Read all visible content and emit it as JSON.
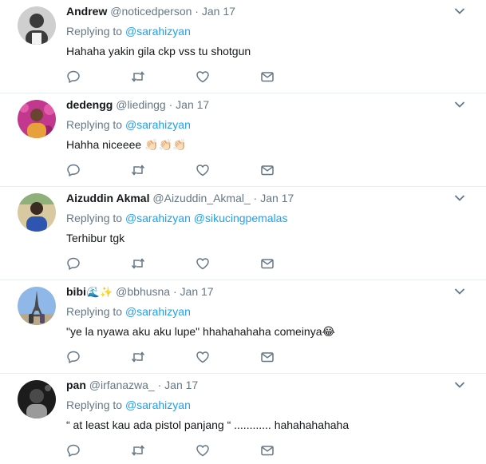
{
  "replying_label": "Replying to",
  "tweets": [
    {
      "name": "Andrew",
      "handle": "@noticedperson",
      "dot": "·",
      "date": "Jan 17",
      "name_emoji": "",
      "mentions": [
        "@sarahizyan"
      ],
      "text": "Hahaha yakin gila ckp vss tu shotgun",
      "avatar_colors": {
        "bg": "#cfcfcf",
        "fg": "#3a3a3a"
      }
    },
    {
      "name": "dedengg",
      "handle": "@liedingg",
      "dot": "·",
      "date": "Jan 17",
      "name_emoji": "",
      "mentions": [
        "@sarahizyan"
      ],
      "text": "Hahha niceeee 👏🏻👏🏻👏🏻",
      "avatar_colors": {
        "bg": "#c2388f",
        "fg": "#e8a13a"
      }
    },
    {
      "name": "Aizuddin Akmal",
      "handle": "@Aizuddin_Akmal_",
      "dot": "·",
      "date": "Jan 17",
      "name_emoji": "",
      "mentions": [
        "@sarahizyan",
        "@sikucingpemalas"
      ],
      "text": "Terhibur tgk",
      "avatar_colors": {
        "bg": "#d9c9a0",
        "fg": "#2e56b0"
      }
    },
    {
      "name": "bibi",
      "handle": "@bbhusna",
      "dot": "·",
      "date": "Jan 17",
      "name_emoji": "🌊✨",
      "mentions": [
        "@sarahizyan"
      ],
      "text": "\"ye la nyawa aku aku lupe\" hhahahahaha comeinya😂",
      "avatar_colors": {
        "bg": "#8fb8e8",
        "fg": "#4a4a4a"
      }
    },
    {
      "name": "pan",
      "handle": "@irfanazwa_",
      "dot": "·",
      "date": "Jan 17",
      "name_emoji": "",
      "mentions": [
        "@sarahizyan"
      ],
      "text": "“ at least kau ada pistol panjang “ ............ hahahahahaha",
      "avatar_colors": {
        "bg": "#1c1c1c",
        "fg": "#9a9a9a"
      }
    }
  ],
  "action_icons": [
    "reply-icon",
    "retweet-icon",
    "like-icon",
    "direct-message-icon"
  ],
  "colors": {
    "link": "#1da1f2",
    "secondary_text": "#657786",
    "icon": "#657786",
    "divider": "#e6ecf0"
  }
}
